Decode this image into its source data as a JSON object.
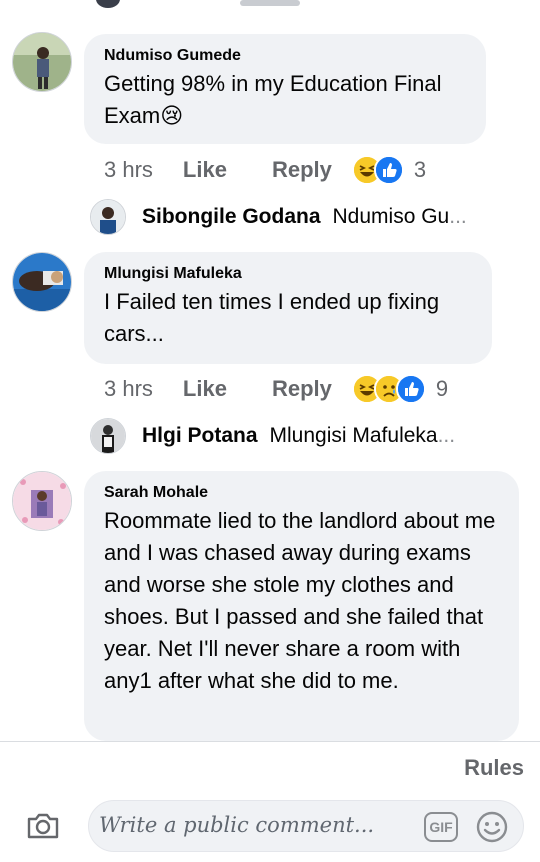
{
  "comments": [
    {
      "author": "Ndumiso Gumede",
      "text": "Getting 98% in my Education Final Exam😢",
      "time": "3 hrs",
      "like": "Like",
      "reply": "Reply",
      "reaction_count": "3",
      "reactions": [
        "haha-icon",
        "like-icon"
      ],
      "reply_preview": {
        "author": "Sibongile Godana",
        "snippet": "Ndumiso Gu",
        "ellipsis": "..."
      }
    },
    {
      "author": "Mlungisi Mafuleka",
      "text": "I Failed ten times I ended up fixing cars...",
      "time": "3 hrs",
      "like": "Like",
      "reply": "Reply",
      "reaction_count": "9",
      "reactions": [
        "haha-icon",
        "sad-icon",
        "like-icon"
      ],
      "reply_preview": {
        "author": "Hlgi Potana",
        "snippet": "Mlungisi Mafuleka",
        "ellipsis": "..."
      }
    },
    {
      "author": "Sarah Mohale",
      "text": "Roommate lied to the landlord about me and I was chased away during exams and worse she stole my clothes and shoes. But I passed and she failed that year. Net I'll never share a room with any1 after what she did to me."
    }
  ],
  "footer": {
    "rules": "Rules",
    "placeholder": "Write a public comment...",
    "gif": "GIF"
  },
  "colors": {
    "bubble": "#f0f2f5",
    "meta": "#65676b",
    "like_blue": "#1877f2",
    "haha_yellow": "#f7c928"
  }
}
